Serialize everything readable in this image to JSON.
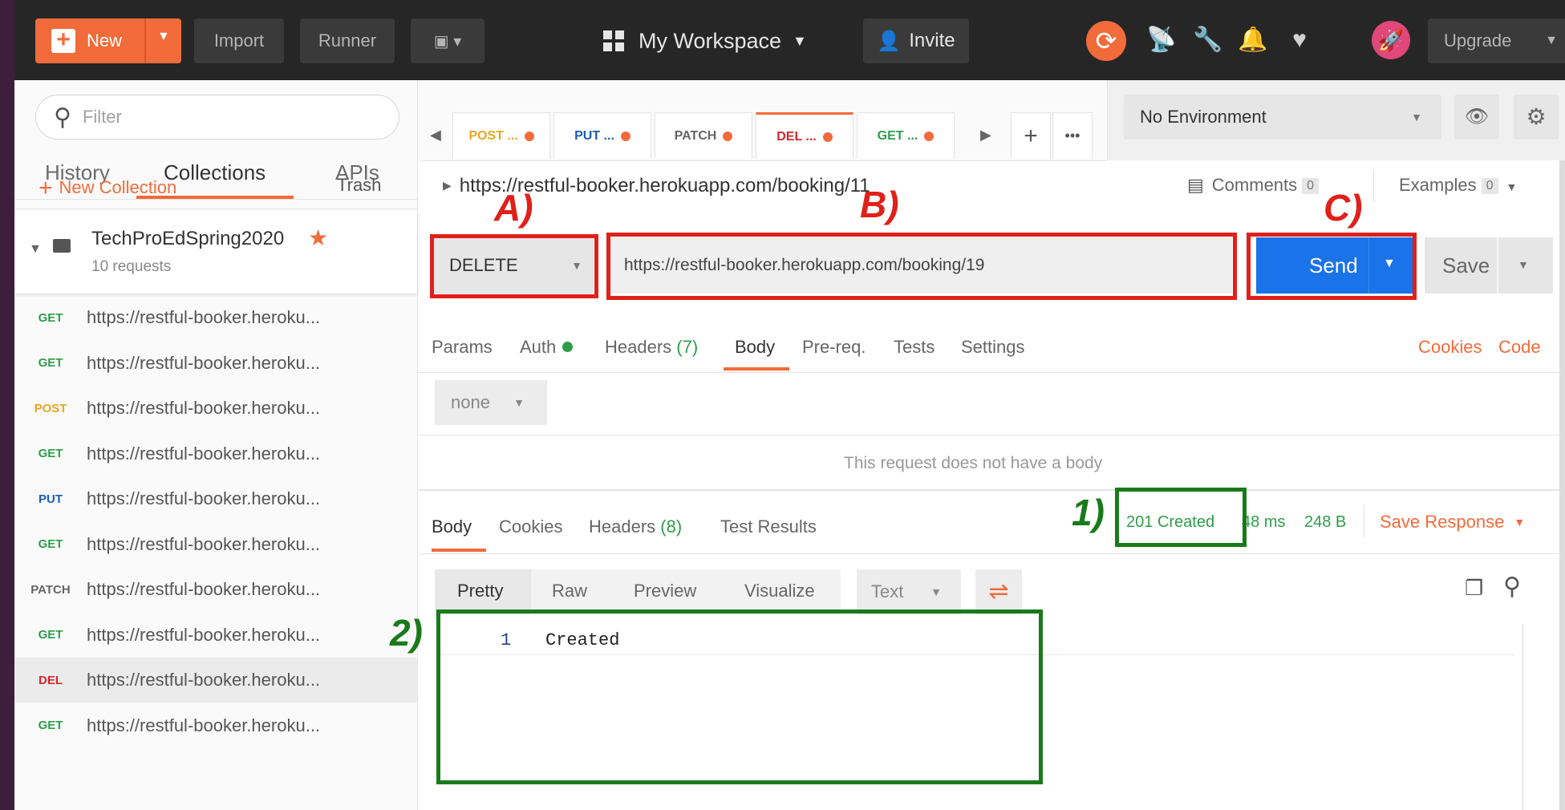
{
  "topbar": {
    "new_label": "New",
    "import_label": "Import",
    "runner_label": "Runner",
    "workspace_label": "My Workspace",
    "invite_label": "Invite",
    "upgrade_label": "Upgrade"
  },
  "sidebar": {
    "filter_placeholder": "Filter",
    "tabs": [
      "History",
      "Collections",
      "APIs"
    ],
    "new_collection_label": "New Collection",
    "trash_label": "Trash",
    "collection": {
      "name": "TechProEdSpring2020",
      "count": "10 requests"
    },
    "requests": [
      {
        "method": "GET",
        "url": "https://restful-booker.heroku..."
      },
      {
        "method": "GET",
        "url": "https://restful-booker.heroku..."
      },
      {
        "method": "POST",
        "url": "https://restful-booker.heroku..."
      },
      {
        "method": "GET",
        "url": "https://restful-booker.heroku..."
      },
      {
        "method": "PUT",
        "url": "https://restful-booker.heroku..."
      },
      {
        "method": "GET",
        "url": "https://restful-booker.heroku..."
      },
      {
        "method": "PATCH",
        "url": "https://restful-booker.heroku..."
      },
      {
        "method": "GET",
        "url": "https://restful-booker.heroku..."
      },
      {
        "method": "DEL",
        "url": "https://restful-booker.heroku..."
      },
      {
        "method": "GET",
        "url": "https://restful-booker.heroku..."
      }
    ]
  },
  "request_tabs": [
    {
      "label": "POST ..."
    },
    {
      "label": "PUT ..."
    },
    {
      "label": "PATCH"
    },
    {
      "label": "DEL ..."
    },
    {
      "label": "GET ..."
    }
  ],
  "environment": {
    "selected": "No Environment"
  },
  "request": {
    "name": "https://restful-booker.herokuapp.com/booking/11",
    "comments_label": "Comments",
    "comments_count": "0",
    "examples_label": "Examples",
    "examples_count": "0",
    "method": "DELETE",
    "url": "https://restful-booker.herokuapp.com/booking/19",
    "send_label": "Send",
    "save_label": "Save",
    "tabs": {
      "params": "Params",
      "auth": "Auth",
      "headers": "Headers",
      "headers_count": "(7)",
      "body": "Body",
      "prereq": "Pre-req.",
      "tests": "Tests",
      "settings": "Settings"
    },
    "cookies_label": "Cookies",
    "code_label": "Code",
    "body_type": "none",
    "no_body_text": "This request does not have a body"
  },
  "response": {
    "tabs": {
      "body": "Body",
      "cookies": "Cookies",
      "headers": "Headers",
      "headers_count": "(8)",
      "test_results": "Test Results"
    },
    "status": "201 Created",
    "time": "48 ms",
    "size": "248 B",
    "save_response_label": "Save Response",
    "formats": [
      "Pretty",
      "Raw",
      "Preview",
      "Visualize"
    ],
    "format_type": "Text",
    "line_number": "1",
    "line_text": "Created"
  },
  "annotations": {
    "a": "A)",
    "b": "B)",
    "c": "C)",
    "one": "1)",
    "two": "2)"
  },
  "colors": {
    "accent": "#f26b3a",
    "send": "#1a73e8",
    "success": "#2e9d4a",
    "annotation_red": "#e0201a",
    "annotation_green": "#1a7a1a"
  }
}
